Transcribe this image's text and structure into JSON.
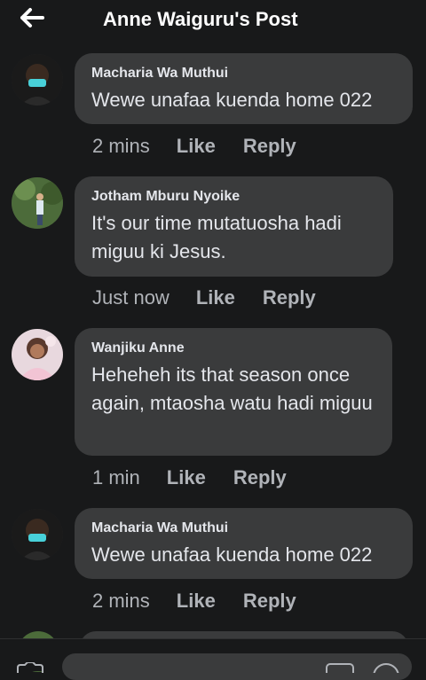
{
  "header": {
    "title": "Anne Waiguru's Post",
    "back_icon": "arrow-left-icon"
  },
  "comments": [
    {
      "author": "Macharia Wa Muthui",
      "text": "Wewe unafaa kuenda home 022",
      "time": "2 mins",
      "like": "Like",
      "reply": "Reply"
    },
    {
      "author": "Jotham Mburu Nyoike",
      "text": "It's  our time mutatuosha hadi miguu ki Jesus.",
      "time": "Just now",
      "like": "Like",
      "reply": "Reply"
    },
    {
      "author": "Wanjiku Anne",
      "text": "Heheheh its that season once again, mtaosha watu hadi miguu",
      "time": "1 min",
      "like": "Like",
      "reply": "Reply"
    },
    {
      "author": "Macharia Wa Muthui",
      "text": "Wewe unafaa kuenda home 022",
      "time": "2 mins",
      "like": "Like",
      "reply": "Reply"
    }
  ],
  "colors": {
    "background": "#18191a",
    "bubble": "#3a3b3c",
    "text": "#e4e6eb",
    "secondary": "#b0b3b8"
  }
}
